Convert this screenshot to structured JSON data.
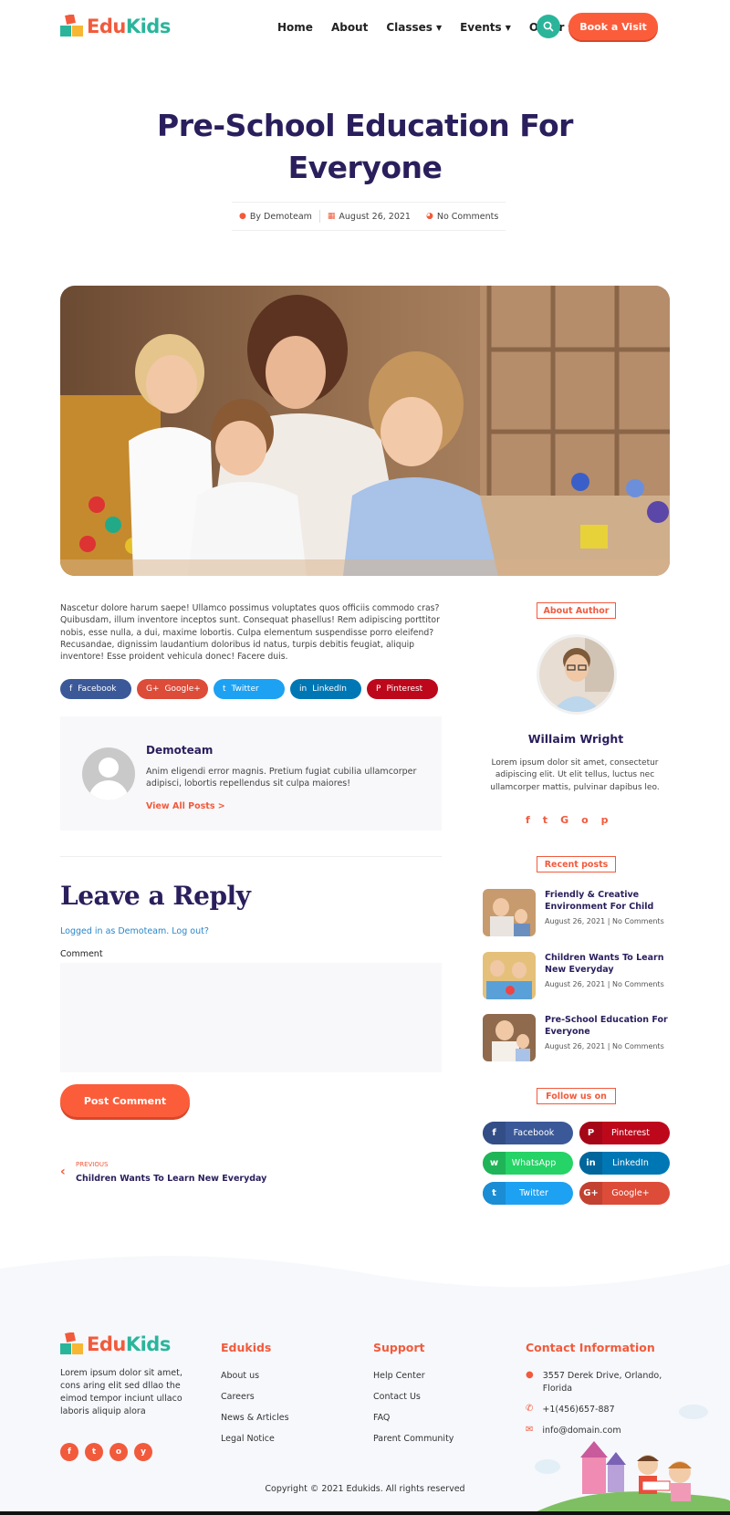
{
  "brand": {
    "name_part1": "Edu",
    "name_part2": "Kids"
  },
  "nav": {
    "items": [
      {
        "label": "Home"
      },
      {
        "label": "About"
      },
      {
        "label": "Classes"
      },
      {
        "label": "Events"
      },
      {
        "label": "Other"
      }
    ],
    "cta": "Book a Visit"
  },
  "post": {
    "title_line1": "Pre-School Education For",
    "title_line2": "Everyone",
    "author": "By Demoteam",
    "date": "August 26, 2021",
    "comments": "No Comments",
    "body": "Nascetur dolore harum saepe! Ullamco possimus voluptates quos officiis commodo cras? Quibusdam, illum inventore inceptos sunt. Consequat phasellus! Rem adipiscing porttitor nobis, esse nulla, a dui, maxime lobortis. Culpa elementum suspendisse porro eleifend? Recusandae, dignissim laudantium doloribus id natus, turpis debitis feugiat, aliquip inventore! Esse proident vehicula donec! Facere duis."
  },
  "share": [
    {
      "label": "Facebook",
      "icon": "f",
      "color": "#3b5998"
    },
    {
      "label": "Google+",
      "icon": "G+",
      "color": "#dd4b39"
    },
    {
      "label": "Twitter",
      "icon": "t",
      "color": "#1da1f2"
    },
    {
      "label": "LinkedIn",
      "icon": "in",
      "color": "#0077b5"
    },
    {
      "label": "Pinterest",
      "icon": "P",
      "color": "#bd081c"
    }
  ],
  "author_box": {
    "name": "Demoteam",
    "bio": "Anim eligendi error magnis. Pretium fugiat cubilia ullamcorper adipisci, lobortis repellendus sit culpa maiores!",
    "link": "View All Posts >"
  },
  "reply": {
    "title": "Leave a Reply",
    "logged_in": "Logged in as Demoteam. Log out?",
    "comment_label": "Comment",
    "submit": "Post Comment"
  },
  "prev_post": {
    "label": "PREVIOUS",
    "title": "Children Wants To Learn New Everyday"
  },
  "sidebar": {
    "about_title": "About Author",
    "author_name": "Willaim Wright",
    "author_bio": "Lorem ipsum dolor sit amet, consectetur adipiscing elit. Ut elit tellus, luctus nec ullamcorper mattis, pulvinar dapibus leo.",
    "author_social": [
      "f",
      "t",
      "G",
      "o",
      "p"
    ],
    "recent_title": "Recent posts",
    "recent": [
      {
        "title": "Friendly & Creative Environment For Child",
        "date": "August 26, 2021",
        "comments": "No Comments"
      },
      {
        "title": "Children Wants To Learn New Everyday",
        "date": "August 26, 2021",
        "comments": "No Comments"
      },
      {
        "title": "Pre-School Education For Everyone",
        "date": "August 26, 2021",
        "comments": "No Comments"
      }
    ],
    "follow_title": "Follow us on",
    "follow": [
      {
        "label": "Facebook",
        "icon": "f",
        "color": "#3b5998",
        "dark": "#334e86"
      },
      {
        "label": "Pinterest",
        "icon": "P",
        "color": "#bd081c",
        "dark": "#a50718"
      },
      {
        "label": "WhatsApp",
        "icon": "w",
        "color": "#25d366",
        "dark": "#1fb457"
      },
      {
        "label": "LinkedIn",
        "icon": "in",
        "color": "#0077b5",
        "dark": "#00669b"
      },
      {
        "label": "Twitter",
        "icon": "t",
        "color": "#1da1f2",
        "dark": "#1a8dd4"
      },
      {
        "label": "Google+",
        "icon": "G+",
        "color": "#dd4b39",
        "dark": "#c24131"
      }
    ]
  },
  "footer": {
    "about": "Lorem ipsum dolor sit amet, cons aring elit sed dllao the eimod tempor inciunt ullaco laboris aliquip alora",
    "col2_title": "Edukids",
    "col2_links": [
      "About us",
      "Careers",
      "News & Articles",
      "Legal Notice"
    ],
    "col3_title": "Support",
    "col3_links": [
      "Help Center",
      "Contact Us",
      "FAQ",
      "Parent Community"
    ],
    "col4_title": "Contact Information",
    "address": "3557 Derek Drive, Orlando, Florida",
    "phone": "+1(456)657-887",
    "email": "info@domain.com",
    "copyright": "Copyright © 2021 Edukids. All rights reserved",
    "social": [
      "f",
      "t",
      "o",
      "y"
    ]
  },
  "colors": {
    "accent": "#f25a3c",
    "teal": "#2ab59b",
    "navy": "#2a1e5c"
  }
}
